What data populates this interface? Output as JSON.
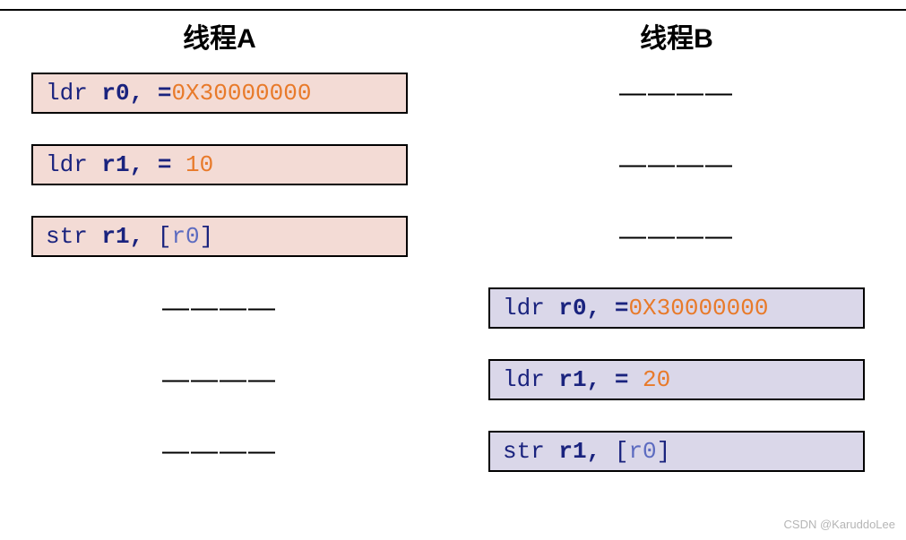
{
  "columns": {
    "a": {
      "title": "线程A"
    },
    "b": {
      "title": "线程B"
    }
  },
  "dash": "————",
  "code": {
    "a1": {
      "inst": "ldr",
      "args": " r0, =",
      "num": "0X30000000"
    },
    "a2": {
      "inst": "ldr",
      "args": " r1, = ",
      "num": "10"
    },
    "a3": {
      "inst": "str",
      "args": " r1, ",
      "br_open": "[",
      "reg": "r0",
      "br_close": "]"
    },
    "b1": {
      "inst": "ldr",
      "args": " r0, =",
      "num": "0X30000000"
    },
    "b2": {
      "inst": "ldr",
      "args": " r1, = ",
      "num": "20"
    },
    "b3": {
      "inst": "str",
      "args": " r1, ",
      "br_open": "[",
      "reg": "r0",
      "br_close": "]"
    }
  },
  "watermark": "CSDN @KaruddoLee"
}
